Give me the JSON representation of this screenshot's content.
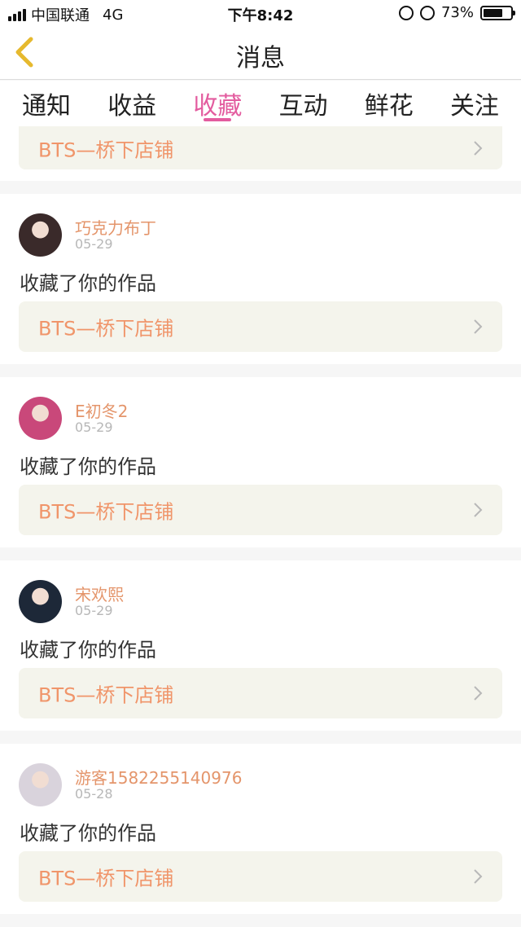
{
  "status_bar": {
    "carrier": "中国联通",
    "network": "4G",
    "time": "下午8:42",
    "battery_percent": "73%",
    "battery_level": 0.73
  },
  "nav": {
    "title": "消息"
  },
  "tabs": [
    {
      "label": "通知",
      "active": false
    },
    {
      "label": "收益",
      "active": false
    },
    {
      "label": "收藏",
      "active": true
    },
    {
      "label": "互动",
      "active": false
    },
    {
      "label": "鲜花",
      "active": false
    },
    {
      "label": "关注",
      "active": false
    }
  ],
  "partial_card": {
    "work_title": "BTS—桥下店铺"
  },
  "notifications": [
    {
      "username": "巧克力布丁",
      "date": "05-29",
      "action": "收藏了你的作品",
      "work_title": "BTS—桥下店铺",
      "avatar_color": "#3a2a2a"
    },
    {
      "username": "E初冬2",
      "date": "05-29",
      "action": "收藏了你的作品",
      "work_title": "BTS—桥下店铺",
      "avatar_color": "#c9487a"
    },
    {
      "username": "宋欢熙",
      "date": "05-29",
      "action": "收藏了你的作品",
      "work_title": "BTS—桥下店铺",
      "avatar_color": "#1d2838"
    },
    {
      "username": "游客1582255140976",
      "date": "05-28",
      "action": "收藏了你的作品",
      "work_title": "BTS—桥下店铺",
      "avatar_color": "#d9d3dc"
    }
  ],
  "colors": {
    "accent": "#e35c9f",
    "username": "#e4956b",
    "work_title": "#f0956a",
    "back_arrow": "#e6b92e"
  }
}
